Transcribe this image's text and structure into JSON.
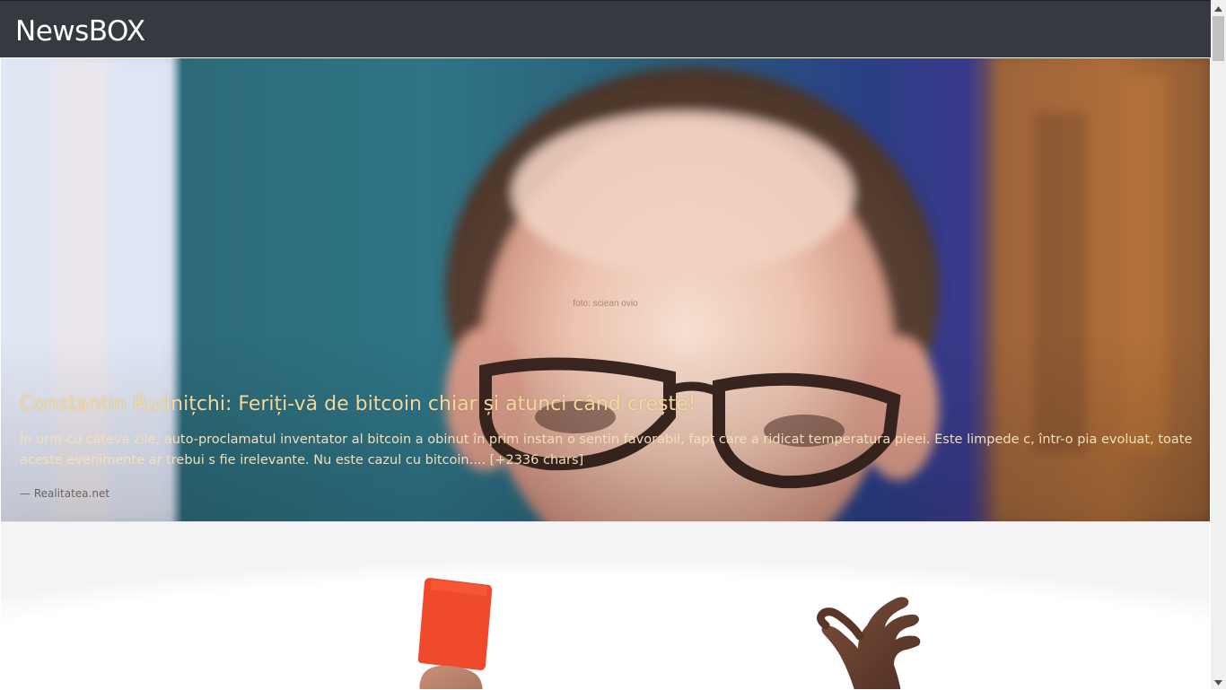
{
  "app": {
    "brand": "NewsBOX"
  },
  "articles": [
    {
      "image_credit": "foto: sciean ovio",
      "title": "Constantin Rudnițchi: Feriți-vă de bitcoin chiar și atunci când crește!",
      "description": "În urm cu câteva zile, auto-proclamatul inventator al bitcoin a obinut în prim instan o sentin favorabil, fapt care a ridicat temperatura pieei. Este limpede c, într-o pia evoluat, toate aceste evenimente ar trebui s fie irelevante. Nu este cazul cu bitcoin.... [+2336 chars]",
      "source": "— Realitatea.net"
    }
  ],
  "colors": {
    "navbar": "#343a40",
    "title": "#f4d79a",
    "description": "#f4dfb8",
    "source": "#6a6460"
  },
  "icons": {
    "scroll_up": "triangle-up-icon",
    "scroll_down": "triangle-down-icon"
  }
}
